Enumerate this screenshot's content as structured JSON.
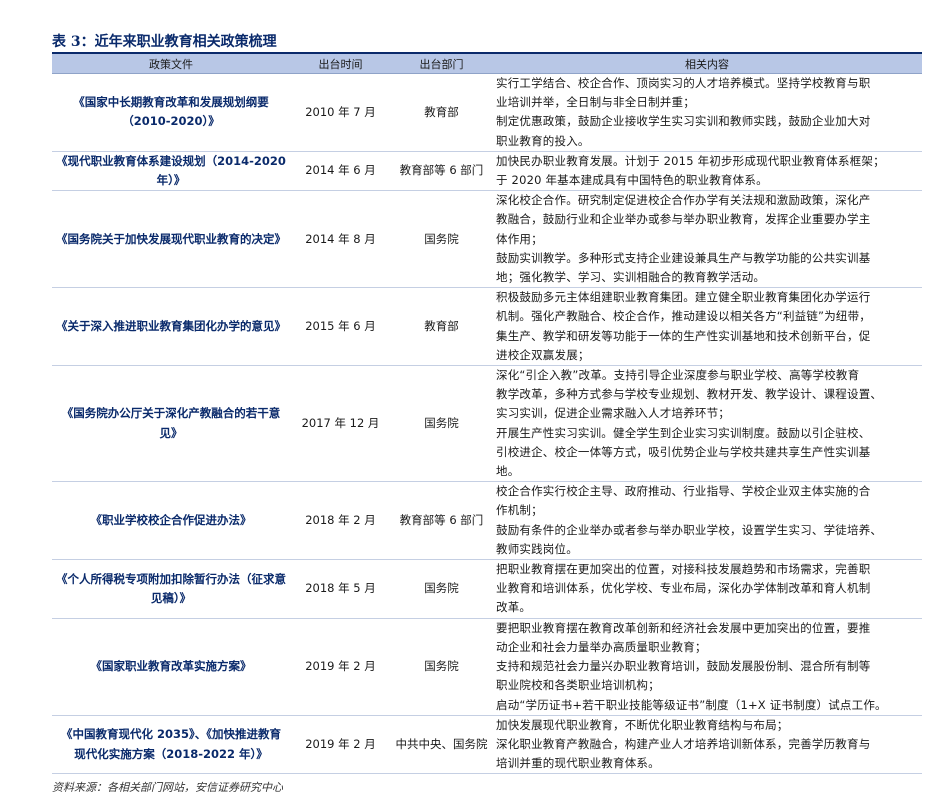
{
  "title": "表 3：近年来职业教育相关政策梳理",
  "headers": [
    "政策文件",
    "出台时间",
    "出台部门",
    "相关内容"
  ],
  "rows": [
    {
      "doc": "《国家中长期教育改革和发展规划纲要（2010-2020）》",
      "date": "2010 年 7 月",
      "dept": "教育部",
      "content": [
        "实行工学结合、校企合作、顶岗实习的人才培养模式。坚持学校教育与职",
        "业培训并举，全日制与非全日制并重；",
        "制定优惠政策，鼓励企业接收学生实习实训和教师实践，鼓励企业加大对",
        "职业教育的投入。"
      ]
    },
    {
      "doc": "《现代职业教育体系建设规划（2014-2020 年）》",
      "date": "2014 年 6 月",
      "dept": "教育部等 6 部门",
      "content": [
        "加快民办职业教育发展。计划于 2015 年初步形成现代职业教育体系框架；",
        "于 2020 年基本建成具有中国特色的职业教育体系。"
      ]
    },
    {
      "doc": "《国务院关于加快发展现代职业教育的决定》",
      "date": "2014 年 8 月",
      "dept": "国务院",
      "content": [
        "深化校企合作。研究制定促进校企合作办学有关法规和激励政策，深化产",
        "教融合，鼓励行业和企业举办或参与举办职业教育，发挥企业重要办学主",
        "体作用；",
        "鼓励实训教学。多种形式支持企业建设兼具生产与教学功能的公共实训基",
        "地；强化教学、学习、实训相融合的教育教学活动。"
      ]
    },
    {
      "doc": "《关于深入推进职业教育集团化办学的意见》",
      "date": "2015 年 6 月",
      "dept": "教育部",
      "content": [
        "积极鼓励多元主体组建职业教育集团。建立健全职业教育集团化办学运行",
        "机制。强化产教融合、校企合作，推动建设以相关各方“利益链”为纽带，",
        "集生产、教学和研发等功能于一体的生产性实训基地和技术创新平台，促",
        "进校企双赢发展；"
      ]
    },
    {
      "doc": "《国务院办公厅关于深化产教融合的若干意见》",
      "date": "2017 年 12 月",
      "dept": "国务院",
      "content": [
        "深化“引企入教”改革。支持引导企业深度参与职业学校、高等学校教育",
        "教学改革，多种方式参与学校专业规划、教材开发、教学设计、课程设置、",
        "实习实训，促进企业需求融入人才培养环节；",
        "开展生产性实习实训。健全学生到企业实习实训制度。鼓励以引企驻校、",
        "引校进企、校企一体等方式，吸引优势企业与学校共建共享生产性实训基",
        "地。"
      ]
    },
    {
      "doc": "《职业学校校企合作促进办法》",
      "date": "2018 年 2 月",
      "dept": "教育部等 6 部门",
      "content": [
        "校企合作实行校企主导、政府推动、行业指导、学校企业双主体实施的合",
        "作机制；",
        "鼓励有条件的企业举办或者参与举办职业学校，设置学生实习、学徒培养、",
        "教师实践岗位。"
      ]
    },
    {
      "doc": "《个人所得税专项附加扣除暂行办法（征求意见稿）》",
      "date": "2018 年 5 月",
      "dept": "国务院",
      "content": [
        "把职业教育摆在更加突出的位置，对接科技发展趋势和市场需求，完善职",
        "业教育和培训体系，优化学校、专业布局，深化办学体制改革和育人机制",
        "改革。"
      ]
    },
    {
      "doc": "《国家职业教育改革实施方案》",
      "date": "2019 年 2 月",
      "dept": "国务院",
      "content": [
        "要把职业教育摆在教育改革创新和经济社会发展中更加突出的位置，要推",
        "动企业和社会力量举办高质量职业教育；",
        "支持和规范社会力量兴办职业教育培训，鼓励发展股份制、混合所有制等",
        "职业院校和各类职业培训机构；",
        "启动“学历证书+若干职业技能等级证书”制度（1+X 证书制度）试点工作。"
      ]
    },
    {
      "doc": "《中国教育现代化 2035》、《加快推进教育现代化实施方案（2018-2022 年）》",
      "date": "2019 年 2 月",
      "dept": "中共中央、国务院",
      "content": [
        "加快发展现代职业教育，不断优化职业教育结构与布局；",
        "深化职业教育产教融合，构建产业人才培养培训新体系，完善学历教育与",
        "培训并重的现代职业教育体系。"
      ]
    }
  ],
  "source": "资料来源：各相关部门网站，安信证券研究中心"
}
